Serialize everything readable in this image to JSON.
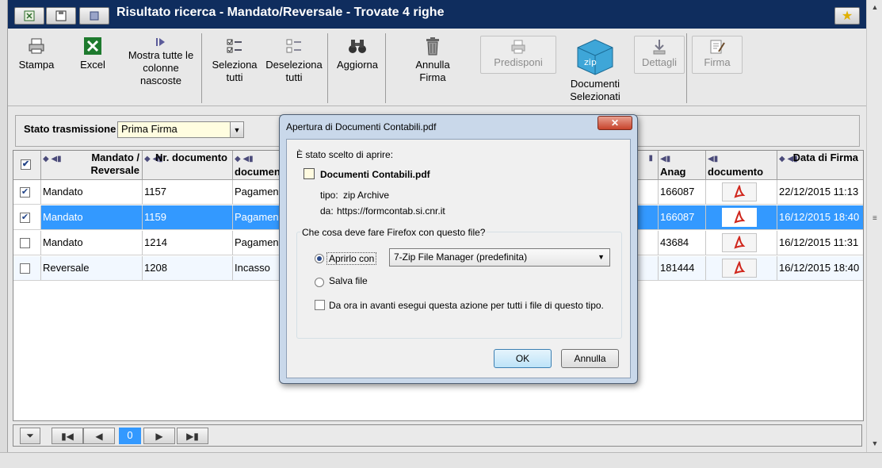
{
  "window": {
    "title": "Risultato ricerca - Mandato/Reversale - Trovate 4 righe"
  },
  "toolbar": {
    "stampa": "Stampa",
    "excel": "Excel",
    "mostra": "Mostra tutte le colonne nascoste",
    "seleziona": "Seleziona tutti",
    "deseleziona": "Deseleziona tutti",
    "aggiorna": "Aggiorna",
    "annulla_firma": "Annulla Firma",
    "predisponi": "Predisponi",
    "documenti": "Documenti Selezionati",
    "dettagli": "Dettagli",
    "firma": "Firma"
  },
  "filter": {
    "label": "Stato trasmissione",
    "value": "Prima Firma"
  },
  "grid": {
    "headers": {
      "mandato": "Mandato / Reversale",
      "nr": "Nr. documento",
      "documento_type": "documen",
      "anag": "Anag",
      "documento": "documento",
      "data": "Data di Firma"
    },
    "rows": [
      {
        "checked": true,
        "tipo": "Mandato",
        "nr": "1157",
        "desc": "Pagamen",
        "anag": "166087",
        "data": "22/12/2015 11:13",
        "selected": false
      },
      {
        "checked": true,
        "tipo": "Mandato",
        "nr": "1159",
        "desc": "Pagamen",
        "anag": "166087",
        "data": "16/12/2015 18:40",
        "selected": true
      },
      {
        "checked": false,
        "tipo": "Mandato",
        "nr": "1214",
        "desc": "Pagamen",
        "anag": "43684",
        "data": "16/12/2015 11:31",
        "selected": false
      },
      {
        "checked": false,
        "tipo": "Reversale",
        "nr": "1208",
        "desc": "Incasso",
        "anag": "181444",
        "data": "16/12/2015 18:40",
        "selected": false
      }
    ]
  },
  "pager": {
    "page": "0"
  },
  "dialog": {
    "title": "Apertura di Documenti Contabili.pdf",
    "intro": "È stato scelto di aprire:",
    "filename": "Documenti Contabili.pdf",
    "tipo_label": "tipo:",
    "tipo_value": "zip Archive",
    "da_label": "da:",
    "da_value": "https://formcontab.si.cnr.it",
    "question": "Che cosa deve fare Firefox con questo file?",
    "open_with": "Aprirlo con",
    "app": "7-Zip File Manager (predefinita)",
    "save_file": "Salva file",
    "remember": "Da ora in avanti esegui questa azione per tutti i file di questo tipo.",
    "ok": "OK",
    "cancel": "Annulla"
  }
}
